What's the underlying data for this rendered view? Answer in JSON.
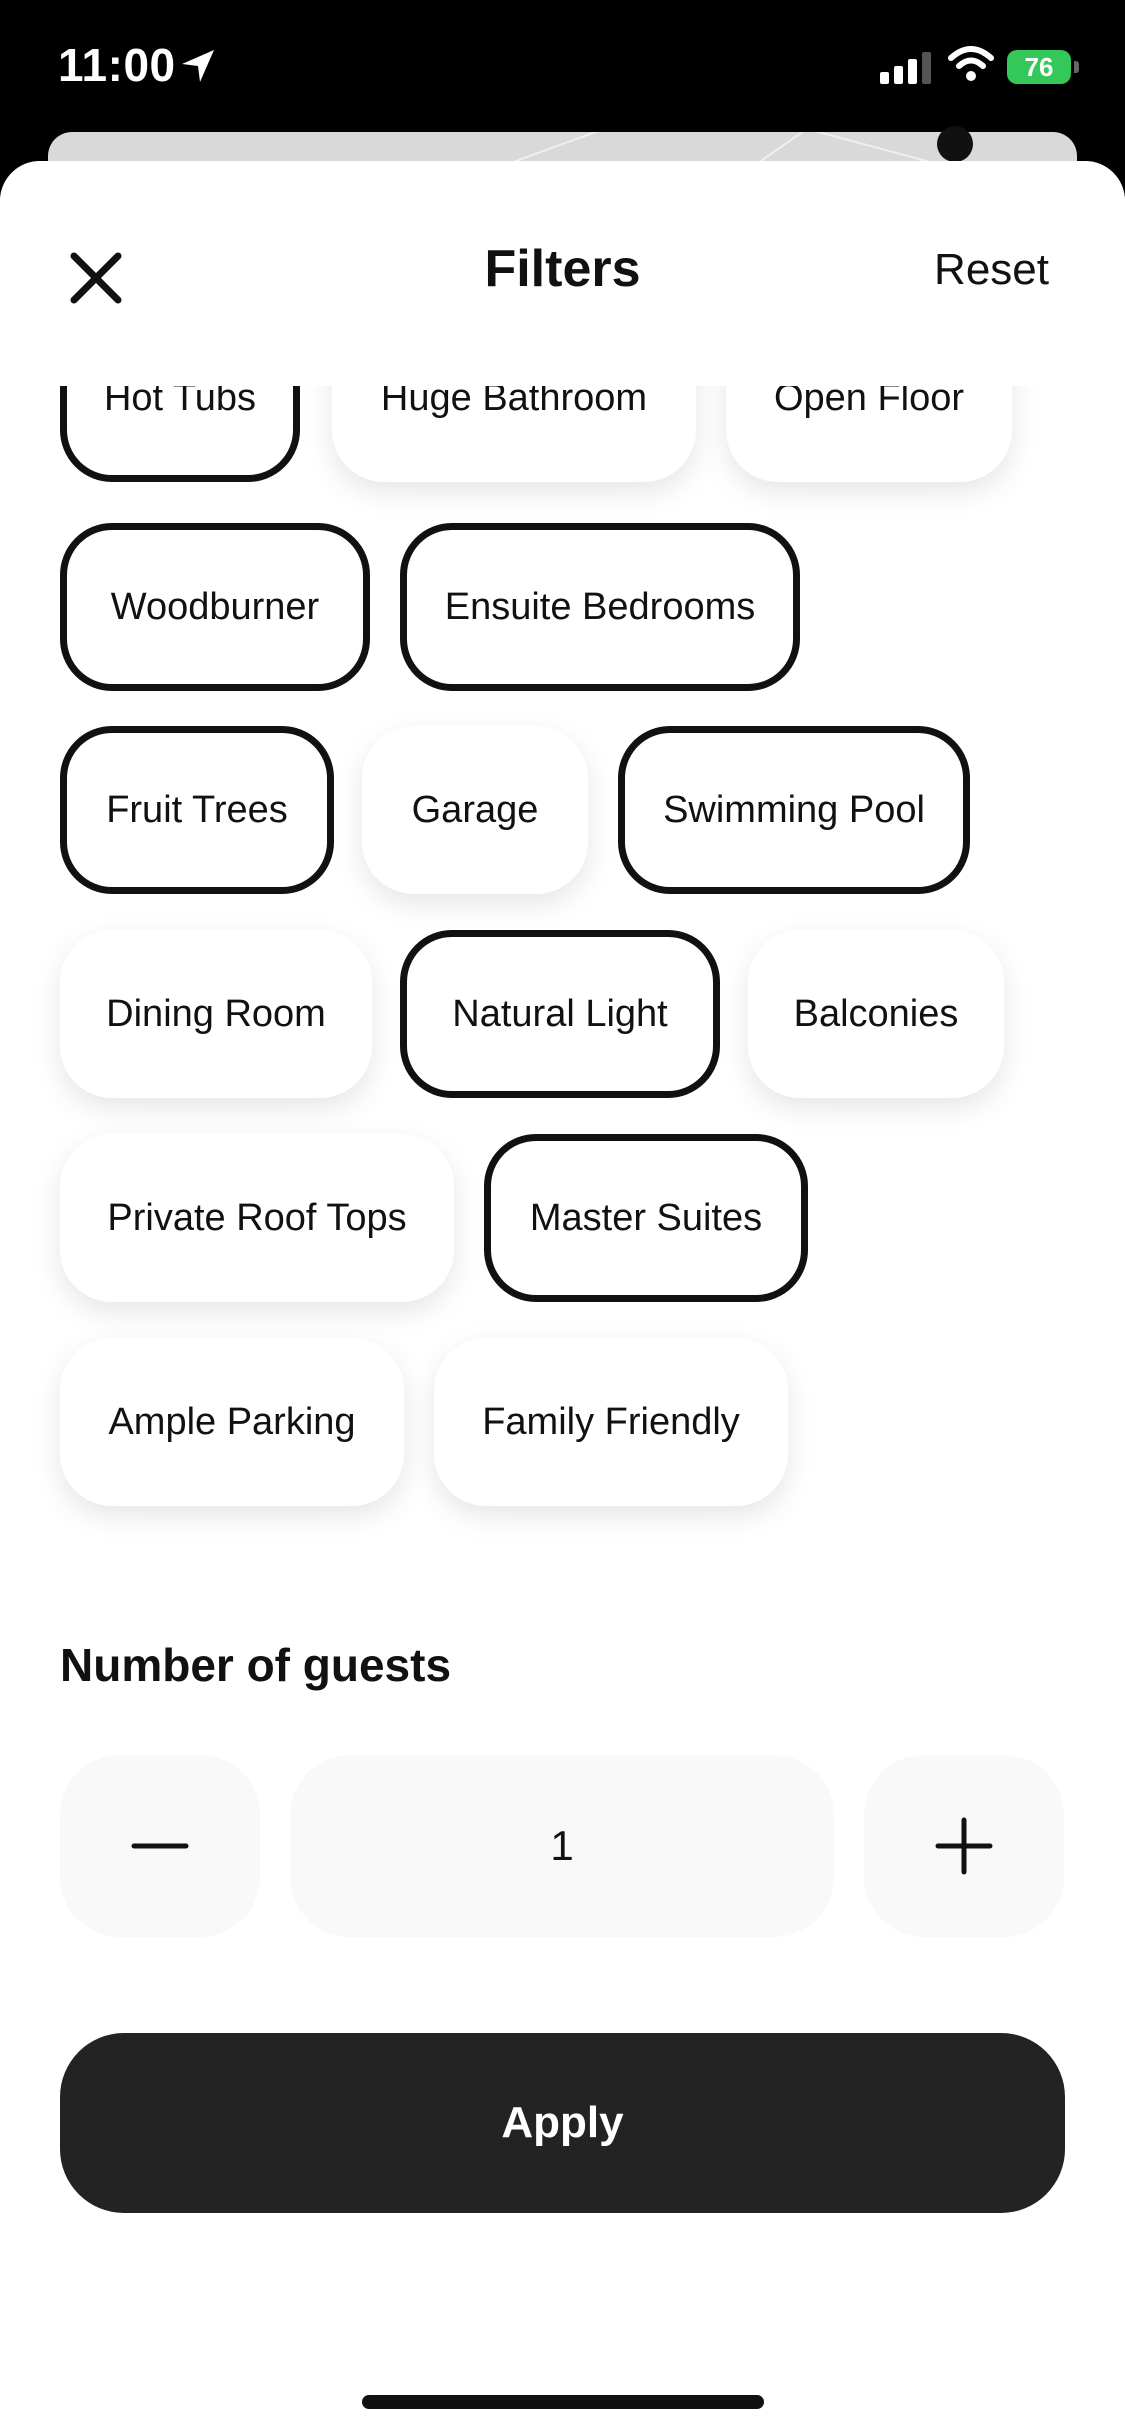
{
  "status": {
    "time": "11:00",
    "battery": "76"
  },
  "header": {
    "title": "Filters",
    "reset_label": "Reset"
  },
  "amenities": [
    {
      "label": "Hot Tubs",
      "selected": true
    },
    {
      "label": "Huge Bathroom",
      "selected": false
    },
    {
      "label": "Open Floor",
      "selected": false
    },
    {
      "label": "Woodburner",
      "selected": true
    },
    {
      "label": "Ensuite Bedrooms",
      "selected": true
    },
    {
      "label": "Fruit Trees",
      "selected": true
    },
    {
      "label": "Garage",
      "selected": false
    },
    {
      "label": "Swimming Pool",
      "selected": true
    },
    {
      "label": "Dining Room",
      "selected": false
    },
    {
      "label": "Natural Light",
      "selected": true
    },
    {
      "label": "Balconies",
      "selected": false
    },
    {
      "label": "Private Roof Tops",
      "selected": false
    },
    {
      "label": "Master Suites",
      "selected": true
    },
    {
      "label": "Ample Parking",
      "selected": false
    },
    {
      "label": "Family Friendly",
      "selected": false
    }
  ],
  "guests": {
    "title": "Number of guests",
    "value": "1"
  },
  "apply_label": "Apply",
  "colors": {
    "accent": "#232323",
    "battery": "#34c759",
    "field_bg": "#f9f9f9"
  }
}
